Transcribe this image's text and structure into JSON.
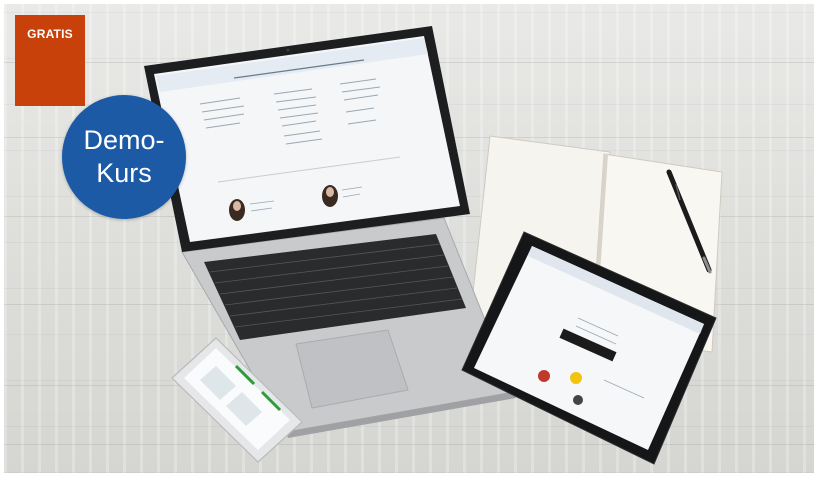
{
  "badge_gratis": {
    "label": "GRATIS"
  },
  "badge_demo": {
    "line1": "Demo-",
    "line2": "Kurs"
  },
  "colors": {
    "gratis_bg": "#c8410b",
    "demo_bg": "#1c5aa6",
    "background": "#e3e3e0"
  },
  "icons": [
    "laptop-icon",
    "tablet-icon",
    "smartphone-icon",
    "notebook-icon",
    "pen-icon"
  ]
}
